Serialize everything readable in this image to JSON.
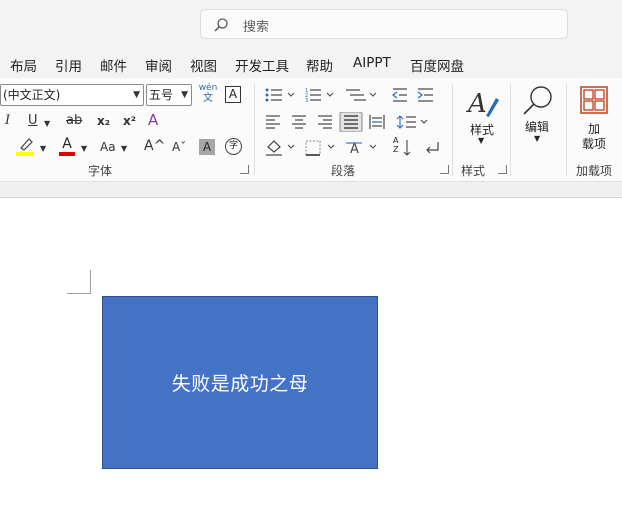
{
  "search": {
    "label": "搜索"
  },
  "menu": {
    "tabs": [
      {
        "label": "布局"
      },
      {
        "label": "引用"
      },
      {
        "label": "邮件"
      },
      {
        "label": "审阅"
      },
      {
        "label": "视图"
      },
      {
        "label": "开发工具"
      },
      {
        "label": "帮助"
      },
      {
        "label": "AIPPT"
      },
      {
        "label": "百度网盘"
      }
    ]
  },
  "font_group": {
    "font_name": "(中文正文)",
    "font_size": "五号",
    "phonetic_top": "wén",
    "phonetic_bottom": "文",
    "border_char": "A",
    "italic": "I",
    "underline": "U",
    "strike": "ab",
    "subscript": "x₂",
    "superscript": "x²",
    "clear_format": "A",
    "font_color": "A",
    "change_case": "Aa",
    "grow": "A^",
    "shrink": "Aˇ",
    "shade": "A",
    "enclose": "字",
    "label": "字体"
  },
  "paragraph_group": {
    "label": "段落",
    "sort_top": "A",
    "sort_bottom": "Z"
  },
  "styles_group": {
    "button_label": "样式",
    "label": "样式"
  },
  "editing": {
    "button_label": "编辑"
  },
  "addins": {
    "button_line1": "加",
    "button_line2": "载项",
    "label": "加载项"
  },
  "colors": {
    "highlight": "#ffff00",
    "font_red": "#e00000",
    "shape_fill": "#4472c4",
    "addin_orange": "#c43e1c"
  },
  "document": {
    "shape_text": "失败是成功之母"
  }
}
